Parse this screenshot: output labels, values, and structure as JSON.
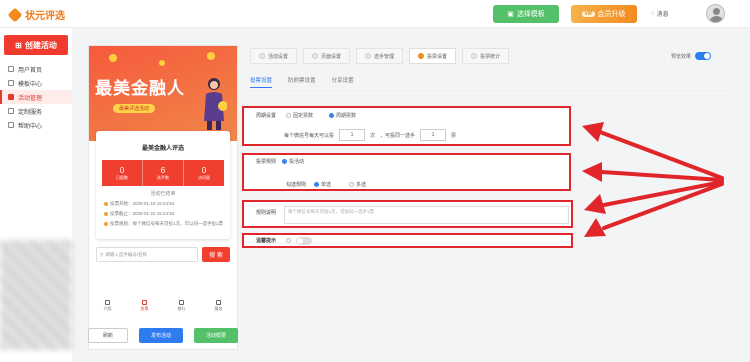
{
  "header": {
    "logo_text": "状元评选",
    "template_button": "选择模板",
    "upgrade_badge": "VIP",
    "upgrade_button": "会员升级",
    "messages": "消息"
  },
  "sidebar": {
    "create_button": "创建活动",
    "items": [
      {
        "label": "用户首页"
      },
      {
        "label": "模板中心"
      },
      {
        "label": "活动管理"
      },
      {
        "label": "定制服务"
      },
      {
        "label": "帮助中心"
      }
    ]
  },
  "preview": {
    "banner_title": "最美金融人",
    "banner_subtitle": "最美评选活动",
    "card_title": "最美金融人评选",
    "stats": [
      {
        "num": "0",
        "label": "已报数"
      },
      {
        "num": "6",
        "label": "选手数"
      },
      {
        "num": "0",
        "label": "访问量"
      }
    ],
    "status": "活动已结束",
    "info": [
      "投票开始：2025-01-16 15:24:54",
      "投票截止：2025-01-22 15:24:54",
      "投票规则：每个微信号每天可投1次，可以同一选手投1票"
    ],
    "search_placeholder": "请输入选手编号/名称",
    "search_button": "搜 索",
    "nav": [
      "介绍",
      "投票",
      "排行",
      "报名"
    ],
    "actions": [
      "刷新",
      "发布活动",
      "活动概要"
    ]
  },
  "tabs": [
    {
      "label": "活动设置"
    },
    {
      "label": "页面设置"
    },
    {
      "label": "选手管理"
    },
    {
      "label": "投票设置"
    },
    {
      "label": "投票统计"
    }
  ],
  "preview_toggle_label": "预览效果",
  "subtabs": [
    "投票设置",
    "防刷票设置",
    "分享设置"
  ],
  "vote_settings": {
    "cycle_label": "周期设置",
    "cycle_options": [
      "固定票数",
      "周期票数"
    ],
    "rule_prefix": "每个微信号每天可以投",
    "times_value": "1",
    "times_unit": "次",
    "rule_middle": "，可投同一选手",
    "votes_value": "1",
    "votes_unit": "票",
    "vote_rule_label": "投票规则",
    "vote_rule_option": "投活动",
    "check_rule_label": "勾选规则",
    "check_options": [
      "单选",
      "多选"
    ],
    "description_label": "规则说明",
    "description_placeholder": "每个微信号每天可投1次，可投同一选手1票",
    "tip_label": "温馨提示"
  }
}
